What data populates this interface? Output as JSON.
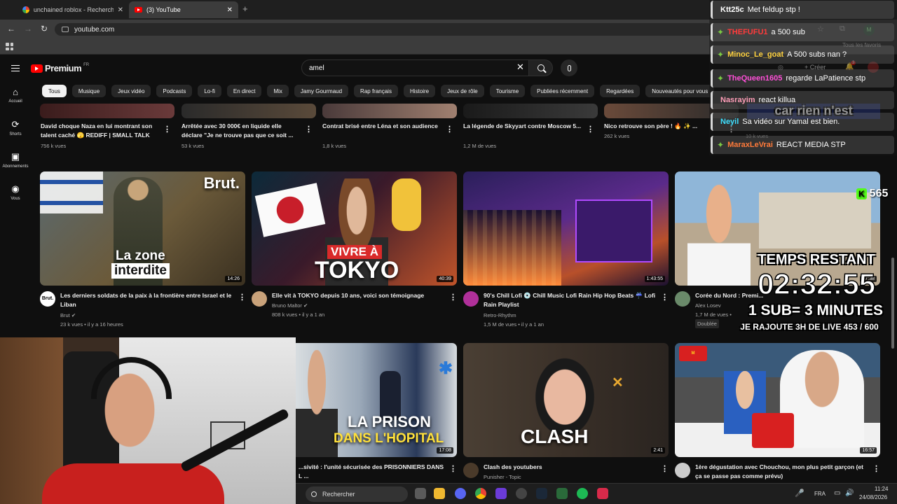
{
  "browser": {
    "tabs": [
      {
        "label": "unchained roblox - Recherche G",
        "active": false
      },
      {
        "label": "(3) YouTube",
        "active": true
      }
    ],
    "new_tab": "+",
    "close": "✕",
    "url": "youtube.com",
    "bookmarks_label": "Tous les favoris"
  },
  "youtube": {
    "logo": "Premium",
    "country": "FR",
    "search_value": "amel",
    "create_label": "+ Créer",
    "notif_count": "3",
    "sidebar": [
      {
        "icon": "⌂",
        "label": "Accueil"
      },
      {
        "icon": "⟳",
        "label": "Shorts"
      },
      {
        "icon": "▣",
        "label": "Abonnements"
      },
      {
        "icon": "◉",
        "label": "Vous"
      }
    ],
    "chips": [
      "Tous",
      "Musique",
      "Jeux vidéo",
      "Podcasts",
      "Lo-fi",
      "En direct",
      "Mix",
      "Jamy Gourmaud",
      "Rap français",
      "Histoire",
      "Jeux de rôle",
      "Tourisme",
      "Publiées récemment",
      "Regardées",
      "Nouveautés pour vous"
    ],
    "row0": [
      {
        "title": "David choque Naza en lui montrant son talent caché 🫣 REDIFF | SMALL TALK",
        "meta": "756 k vues"
      },
      {
        "title": "Arrêtée avec 30 000€ en liquide elle déclare \"Je ne trouve pas que ce soit ...",
        "meta": "53 k vues"
      },
      {
        "title": "Contrat brisé entre Léna et son audience",
        "meta": "1,8 k vues"
      },
      {
        "title": "La légende de Skyyart contre Moscow 5...",
        "meta": "1,2 M de vues"
      },
      {
        "title": "Nico retrouve son père ! 🔥 ✨ ...",
        "meta": "262 k vues"
      },
      {
        "title": "car rien n'est",
        "meta": "10 k vues"
      }
    ],
    "row1": [
      {
        "title": "Les derniers soldats de la paix à la frontière entre Israel et le Liban",
        "channel": "Brut ✔",
        "meta": "23 k vues • il y a 16 heures",
        "duration": "14:26",
        "overlay1": "La zone",
        "overlay2": "interdite",
        "brand": "Brut.",
        "avatar": "Brut."
      },
      {
        "title": "Elle vit à TOKYO depuis 10 ans, voici son témoignage",
        "channel": "Bruno Maltor ✔",
        "meta": "808 k vues • il y a 1 an",
        "duration": "40:39",
        "overlay1": "VIVRE À",
        "overlay2": "TOKYO"
      },
      {
        "title": "90's Chill Lofi 💿 Chill Music Lofi Rain Hip Hop Beats ☔ Lofi Rain Playlist",
        "channel": "Retro-Rhythm",
        "meta": "1,5 M de vues • il y a 1 an",
        "duration": "1:43:55"
      },
      {
        "title": "Corée du Nord : Premi...",
        "channel": "Alex Losev",
        "meta": "1,7 M de vues •",
        "duration": "17:38",
        "badge": "Doublée"
      }
    ],
    "row2": [
      {
        "title": "...sivité : l'unité sécurisée des PRISONNIERS DANS L ...",
        "duration": "17:08",
        "overlay1": "LA PRISON",
        "overlay2": "DANS L'HOPITAL"
      },
      {
        "title": "Clash des youtubers",
        "channel": "Punisher - Topic",
        "duration": "2:41",
        "overlay1": "CLASH"
      },
      {
        "title": "1ère dégustation avec Chouchou, mon plus petit garçon (et ça se passe pas comme prévu)",
        "duration": "16:57"
      }
    ]
  },
  "chat": [
    {
      "user": "Ktt25c",
      "color": "#ffffff",
      "text": "Met feldup stp !",
      "badge": ""
    },
    {
      "user": "THEFUFU1",
      "color": "#ff3b3b",
      "text": "a 500 sub",
      "badge": "✦"
    },
    {
      "user": "Minoc_Le_goat",
      "color": "#ffd23f",
      "text": "A 500 subs nan ?",
      "badge": "✦"
    },
    {
      "user": "TheQueen1605",
      "color": "#ff4fd8",
      "text": "regarde LaPatience stp",
      "badge": "✦"
    },
    {
      "user": "Nasrayim",
      "color": "#ff9eb8",
      "text": "react killua",
      "badge": ""
    },
    {
      "user": "Neyil",
      "color": "#3fe0ff",
      "text": "Sa vidéo sur Yamal est bien.",
      "badge": ""
    },
    {
      "user": "MaraxLeVrai",
      "color": "#ff7a3a",
      "text": "REACT MEDIA STP",
      "badge": "✦"
    }
  ],
  "overlay": {
    "kick_icon": "K",
    "kick_count": "565",
    "temps": "TEMPS RESTANT",
    "timer": "02:32:55",
    "rule": "1 SUB= 3 MINUTES",
    "goal": "JE RAJOUTE 3H DE LIVE 453 / 600"
  },
  "taskbar": {
    "search": "Rechercher",
    "lang": "FRA",
    "time": "11:24",
    "date": "24/08/2026"
  }
}
